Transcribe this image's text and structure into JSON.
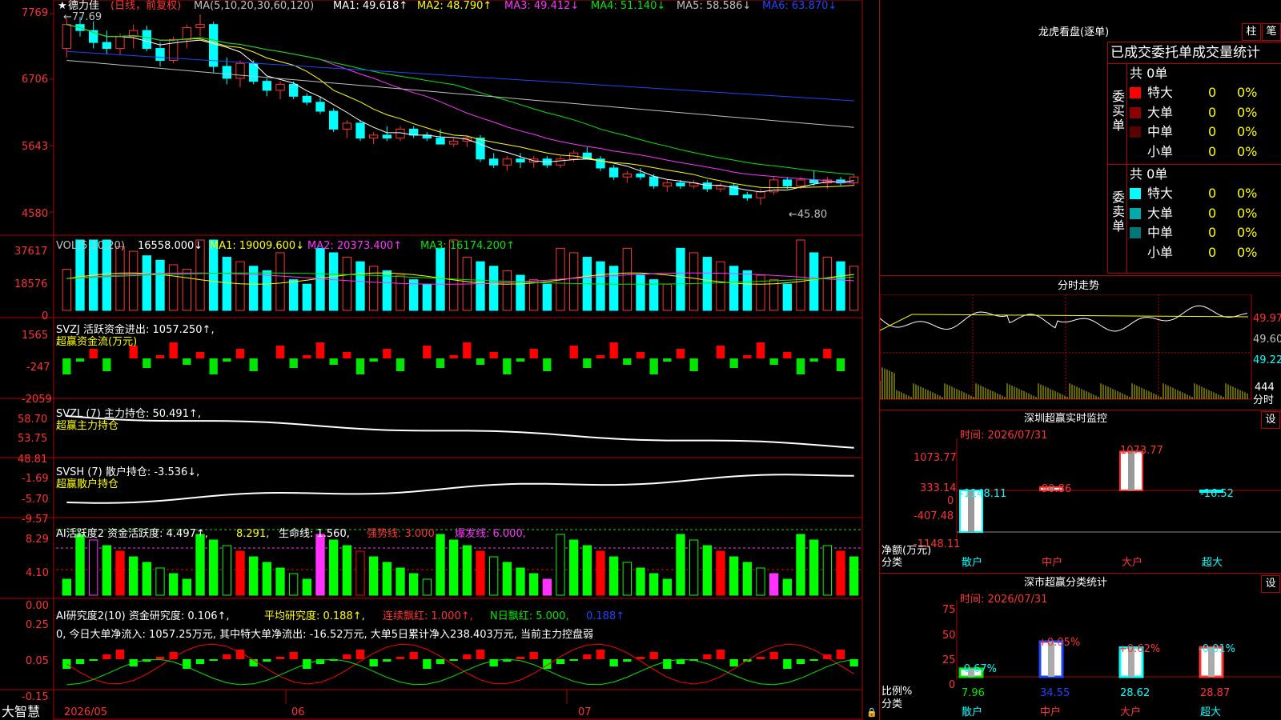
{
  "stock": {
    "name": "德力佳",
    "tag": "(日线，前复权)",
    "star": "★"
  },
  "ma": {
    "label": "MA(5,10,20,30,60,120)",
    "ma1": "MA1: 49.618↑",
    "ma2": "MA2: 48.790↑",
    "ma3": "MA3: 49.412↓",
    "ma4": "MA4: 51.140↓",
    "ma5": "MA5: 58.586↓",
    "ma6": "MA6: 63.870↓"
  },
  "price_axis": [
    "7769",
    "6706",
    "5643",
    "4580"
  ],
  "price_marks": {
    "high": "←77.69",
    "low": "←45.80"
  },
  "vol": {
    "label": "VOL(5,10,20)",
    "value": "16558.000↓",
    "ma1": "MA1: 19009.600↓",
    "ma2": "MA2: 20373.400↑",
    "ma3": "MA3: 16174.200↑",
    "axis": [
      "37617",
      "18576",
      "0"
    ]
  },
  "svzj": {
    "label": "SVZJ  活跃资金进出: 1057.250↑,",
    "sub": "超赢资金流(万元)",
    "axis": [
      "1565",
      "-247",
      "-2059"
    ]
  },
  "svzl": {
    "label": "SVZL (7) 主力持仓: 50.491↑,",
    "sub": "超赢主力持仓",
    "axis": [
      "58.70",
      "53.75",
      "48.81"
    ]
  },
  "svsh": {
    "label": "SVSH (7) 散户持仓: -3.536↓,",
    "sub": "超赢散户持仓",
    "axis": [
      "-1.69",
      "-5.70",
      "-9.57"
    ]
  },
  "ai1": {
    "label": "AI活跃度2 资金活跃度: 4.497↑,",
    "v1": "8.291,",
    "v2": "生命线: 1.560,",
    "v3": "强势线: 3.000,",
    "v4": "爆发线: 6.000,",
    "axis": [
      "8.29",
      "4.10",
      "0.00"
    ]
  },
  "ai2": {
    "label": "AI研究度2(10) 资金研究度: 0.106↑,",
    "v1": "平均研究度: 0.188↑,",
    "v2": "连续飘红: 1.000↑,",
    "v3": "N日飘红: 5.000,",
    "v4": "0.188↑",
    "note": "0, 今日大单净流入: 1057.25万元, 其中特大单净流出: -16.52万元, 大单5日累计净入238.403万元, 当前主力控盘弱",
    "axis": [
      "0.25",
      "0.05",
      "-0.15"
    ]
  },
  "date_axis": {
    "brand": "大智慧",
    "d1": "2026/05",
    "d2": "06",
    "d3": "07"
  },
  "dragon": {
    "title": "龙虎看盘(逐单)",
    "btn1": "柱",
    "btn2": "笔",
    "sub": "已成交委托单成交量统计",
    "buy_side": "委买单",
    "sell_side": "委卖单",
    "buy_total": "共 0单",
    "sell_total": "共 0单",
    "buy_rows": [
      {
        "label": "特大",
        "n": "0",
        "p": "0%",
        "color": "#ff0000"
      },
      {
        "label": "大单",
        "n": "0",
        "p": "0%",
        "color": "#8c0000"
      },
      {
        "label": "中单",
        "n": "0",
        "p": "0%",
        "color": "#5a0000"
      },
      {
        "label": "小单",
        "n": "0",
        "p": "0%",
        "color": "#000000"
      }
    ],
    "sell_rows": [
      {
        "label": "特大",
        "n": "0",
        "p": "0%",
        "color": "#00ffff"
      },
      {
        "label": "大单",
        "n": "0",
        "p": "0%",
        "color": "#00aaaa"
      },
      {
        "label": "中单",
        "n": "0",
        "p": "0%",
        "color": "#007878"
      },
      {
        "label": "小单",
        "n": "0",
        "p": "0%",
        "color": "#000000"
      }
    ]
  },
  "intraday": {
    "title": "分时走势",
    "p1": "49.97",
    "p2": "49.60",
    "p3": "49.22",
    "vol": "444",
    "vol_label": "分时"
  },
  "monitor": {
    "title": "深圳超赢实时监控",
    "set": "设",
    "time": "时间: 2026/07/31",
    "axis": [
      "1073.77",
      "333.14",
      "0",
      "-407.48",
      "-1148.11"
    ],
    "ylabel": "净额(万元)",
    "xlabel": "分类",
    "values": [
      "-1148.11",
      "90.86",
      "1073.77",
      "-16.52"
    ],
    "cats": [
      "散户",
      "中户",
      "大户",
      "超大"
    ]
  },
  "classify": {
    "title": "深市超赢分类统计",
    "set": "设",
    "time": "时间: 2026/07/31",
    "axis": [
      "75",
      "50",
      "25",
      "0"
    ],
    "ylabel": "比例%",
    "xlabel": "分类",
    "changes": [
      "-0.67%",
      "+0.05%",
      "+0.62%",
      "-0.01%"
    ],
    "values": [
      "7.96",
      "34.55",
      "28.62",
      "28.87"
    ],
    "cats": [
      "散户",
      "中户",
      "大户",
      "超大"
    ]
  },
  "candles": [
    [
      72.0,
      77.0,
      70.5,
      76.0
    ],
    [
      76.0,
      77.3,
      74.0,
      75.0
    ],
    [
      75.0,
      76.5,
      72.0,
      73.0
    ],
    [
      73.0,
      75.0,
      71.0,
      72.0
    ],
    [
      72.0,
      74.5,
      71.0,
      74.0
    ],
    [
      74.0,
      76.0,
      72.0,
      75.0
    ],
    [
      75.0,
      75.8,
      71.5,
      72.0
    ],
    [
      72.0,
      73.0,
      69.0,
      70.0
    ],
    [
      70.0,
      74.0,
      69.5,
      73.5
    ],
    [
      73.5,
      76.0,
      72.0,
      75.5
    ],
    [
      75.5,
      77.69,
      74.0,
      76.0
    ],
    [
      76.0,
      76.5,
      68.0,
      69.0
    ],
    [
      69.0,
      70.5,
      66.0,
      67.0
    ],
    [
      67.0,
      70.0,
      65.5,
      69.5
    ],
    [
      69.5,
      70.0,
      66.0,
      66.5
    ],
    [
      66.5,
      67.0,
      64.0,
      65.0
    ],
    [
      65.0,
      66.5,
      63.5,
      66.0
    ],
    [
      66.0,
      66.5,
      63.5,
      64.0
    ],
    [
      64.0,
      64.5,
      62.5,
      63.0
    ],
    [
      63.0,
      64.0,
      61.0,
      61.5
    ],
    [
      61.5,
      62.0,
      58.0,
      58.5
    ],
    [
      58.5,
      60.0,
      57.0,
      59.5
    ],
    [
      59.5,
      60.0,
      56.5,
      57.0
    ],
    [
      57.0,
      58.0,
      56.0,
      57.5
    ],
    [
      57.5,
      59.0,
      56.5,
      57.0
    ],
    [
      57.0,
      59.0,
      56.5,
      58.5
    ],
    [
      58.5,
      59.0,
      57.0,
      57.5
    ],
    [
      57.5,
      58.0,
      56.5,
      57.0
    ],
    [
      57.0,
      58.5,
      56.0,
      56.0
    ],
    [
      56.0,
      57.0,
      55.5,
      56.5
    ],
    [
      56.5,
      57.5,
      55.5,
      57.0
    ],
    [
      57.0,
      57.5,
      53.0,
      53.5
    ],
    [
      53.5,
      54.5,
      52.0,
      52.5
    ],
    [
      52.5,
      54.0,
      51.5,
      53.5
    ],
    [
      53.5,
      54.5,
      52.0,
      53.0
    ],
    [
      53.0,
      54.0,
      52.0,
      53.5
    ],
    [
      53.5,
      54.0,
      52.0,
      52.5
    ],
    [
      52.5,
      54.0,
      52.0,
      53.5
    ],
    [
      53.5,
      55.0,
      53.0,
      54.5
    ],
    [
      54.5,
      55.5,
      53.5,
      53.5
    ],
    [
      53.5,
      54.0,
      51.5,
      52.0
    ],
    [
      52.0,
      52.5,
      50.0,
      50.5
    ],
    [
      50.5,
      51.5,
      49.5,
      51.0
    ],
    [
      51.0,
      52.0,
      50.0,
      50.5
    ],
    [
      50.5,
      51.0,
      48.5,
      49.0
    ],
    [
      49.0,
      50.0,
      48.0,
      49.5
    ],
    [
      49.5,
      50.0,
      48.5,
      49.0
    ],
    [
      49.0,
      50.0,
      48.5,
      49.5
    ],
    [
      49.5,
      50.0,
      48.0,
      48.5
    ],
    [
      48.5,
      49.5,
      48.0,
      49.0
    ],
    [
      49.0,
      49.5,
      47.5,
      47.5
    ],
    [
      47.5,
      48.0,
      46.5,
      47.0
    ],
    [
      47.0,
      48.5,
      45.8,
      48.0
    ],
    [
      48.0,
      50.5,
      47.5,
      50.0
    ],
    [
      50.0,
      50.5,
      48.5,
      49.0
    ],
    [
      49.0,
      50.5,
      48.5,
      50.0
    ],
    [
      50.0,
      51.5,
      49.0,
      49.5
    ],
    [
      49.5,
      50.5,
      48.5,
      50.0
    ],
    [
      50.0,
      50.5,
      49.0,
      49.5
    ],
    [
      49.5,
      51.0,
      49.0,
      50.5
    ]
  ]
}
